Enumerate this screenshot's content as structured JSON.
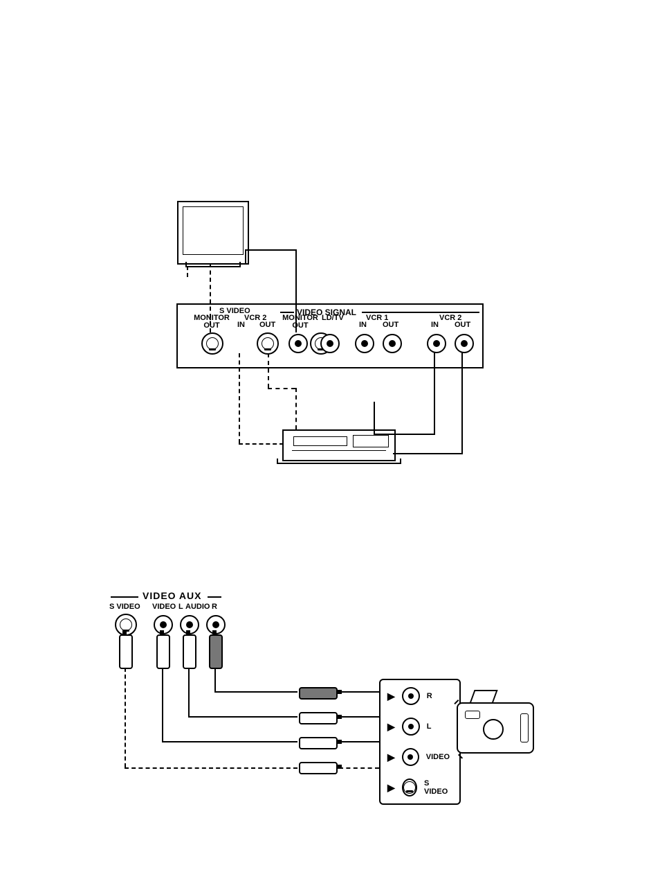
{
  "rear_panel": {
    "group_s_video": "S VIDEO",
    "group_video_signal": "VIDEO SIGNAL",
    "monitor_out_1": "MONITOR\nOUT",
    "vcr2_a": "VCR 2",
    "in": "IN",
    "out": "OUT",
    "monitor_out_2": "MONITOR\nOUT",
    "ld_tv": "LD/TV",
    "vcr1": "VCR 1",
    "vcr2_b": "VCR 2"
  },
  "front_panel": {
    "title": "VIDEO  AUX",
    "s_video": "S VIDEO",
    "video": "VIDEO",
    "audio_l": "L",
    "audio_word": "AUDIO",
    "audio_r": "R"
  },
  "camera_out": {
    "r": "R",
    "l": "L",
    "video": "VIDEO",
    "s_video": "S VIDEO"
  }
}
